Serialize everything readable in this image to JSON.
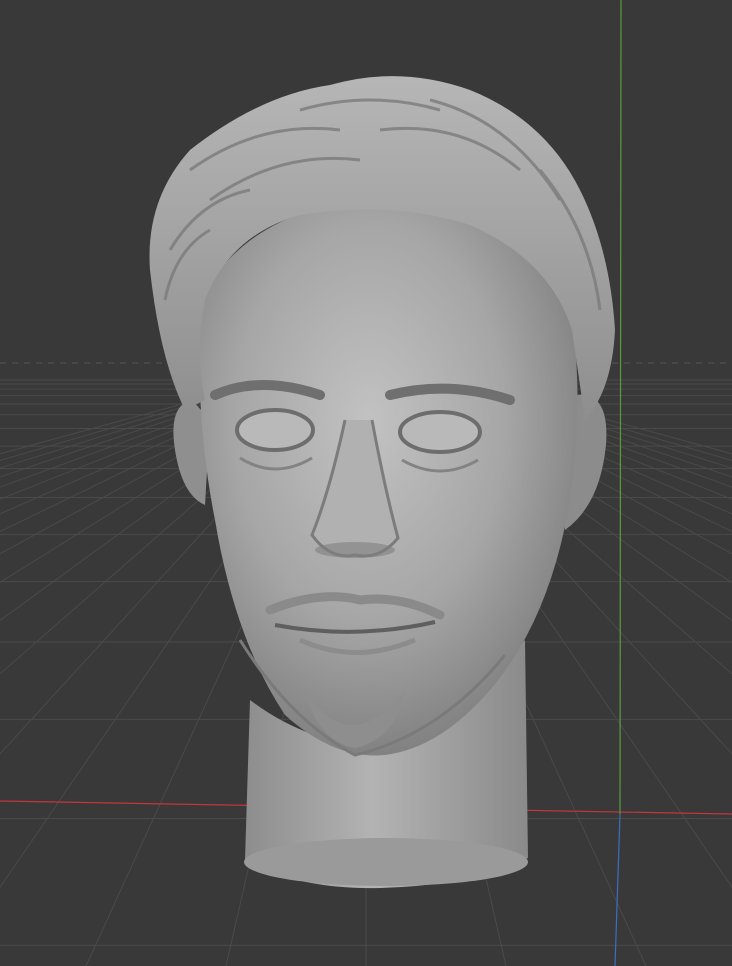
{
  "viewport": {
    "background_color": "#393939",
    "grid_color": "#4a4a4a",
    "horizon_color": "#555555",
    "x_axis_color": "#c4353d",
    "y_axis_color": "#5a9c3c",
    "z_axis_color": "#3a6ec2",
    "model_color": "#a9a9a9",
    "model_icon": "sculpted-head-model"
  }
}
